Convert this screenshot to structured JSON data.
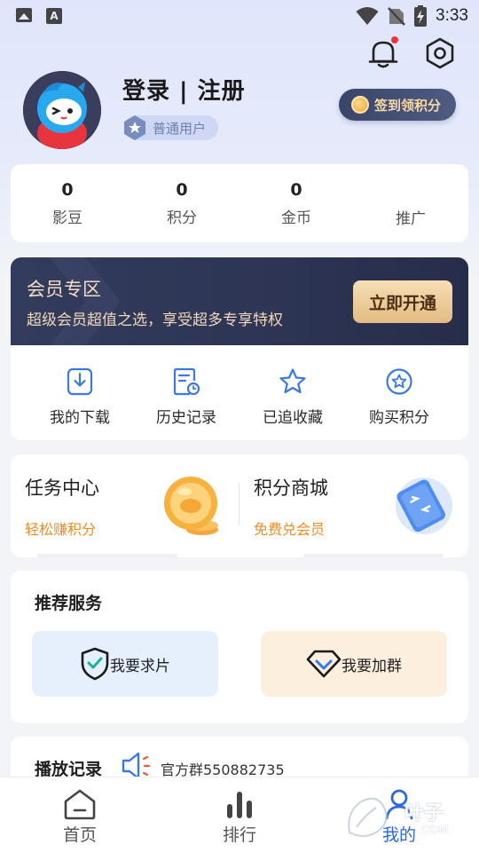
{
  "status_bar": {
    "time": "3:33"
  },
  "header": {
    "user_name": "登录 | 注册",
    "user_level": "普通用户",
    "checkin_label": "签到领积分"
  },
  "stats": [
    {
      "value": "0",
      "label": "影豆"
    },
    {
      "value": "0",
      "label": "积分"
    },
    {
      "value": "0",
      "label": "金币"
    },
    {
      "value": "",
      "label": "推广"
    }
  ],
  "vip": {
    "title": "会员专区",
    "description": "超级会员超值之选，享受超多专享特权",
    "button_label": "立即开通",
    "items": [
      {
        "label": "我的下载",
        "icon": "download-icon"
      },
      {
        "label": "历史记录",
        "icon": "history-icon"
      },
      {
        "label": "已追收藏",
        "icon": "star-icon"
      },
      {
        "label": "购买积分",
        "icon": "star-circle-icon"
      }
    ]
  },
  "task_center": {
    "title": "任务中心",
    "subtitle": "轻松赚积分"
  },
  "points_shop": {
    "title": "积分商城",
    "subtitle": "免费兑会员"
  },
  "recommend": {
    "title": "推荐服务",
    "request_label": "我要求片",
    "join_label": "我要加群"
  },
  "playback": {
    "title": "播放记录",
    "notice": "官方群550882735"
  },
  "bottom_nav": [
    {
      "label": "首页",
      "icon": "home-icon",
      "active": false
    },
    {
      "label": "排行",
      "icon": "ranking-icon",
      "active": false
    },
    {
      "label": "我的",
      "icon": "profile-icon",
      "active": true
    }
  ],
  "watermark": {
    "text": "叶子",
    "sub": ".COM"
  },
  "colors": {
    "accent": "#2b66e8",
    "orange": "#f28a1f",
    "vip_bg": "#2d3454",
    "vip_gold": "#e3bb82"
  }
}
